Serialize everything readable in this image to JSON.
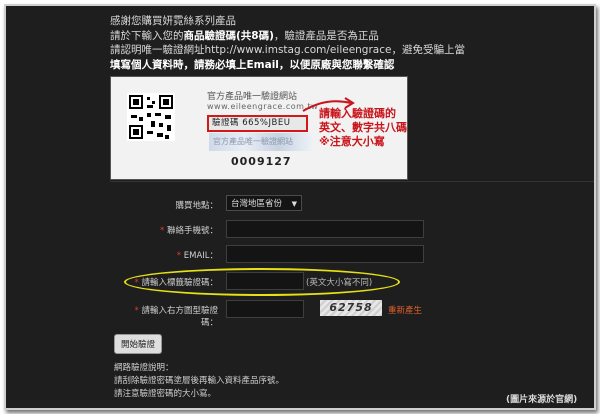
{
  "intro": {
    "line1": "感謝您購買妍霓絲系列產品",
    "line2_pre": "請於下輸入您的",
    "line2_hl": "商品驗證碼(共8碼)",
    "line2_post": "，驗證產品是否為正品",
    "line3": "請認明唯一驗證網址http://www.imstag.com/eileengrace，避免受騙上當",
    "line4": "填寫個人資料時，請務必填上Email，以便原廠與您聯繫確認"
  },
  "sample": {
    "brand": "官方產品唯一驗證網站",
    "brand_url": "www.eileengrace.com.tw",
    "code": "驗證碼 665%JBEU",
    "hologram": "官方產品唯一驗證網站",
    "serial": "0009127",
    "annotation_line1": "請輸入驗證碼的",
    "annotation_line2": "英文、數字共八碼",
    "annotation_line3": "※注意大小寫",
    "annotation_color": "#c8141a"
  },
  "form": {
    "purchase_label": "購買地點：",
    "purchase_value": "台灣地區省份",
    "phone_label": "聯絡手機號：",
    "email_label": "EMAIL：",
    "code_label": "請輸入標籤驗證碼：",
    "code_hint": "(英文大小寫不同)",
    "captcha_label": "請輸入右方圖型驗證碼：",
    "captcha_value": "62758",
    "refresh_label": "重新產生",
    "required_mark": "*",
    "highlight_color": "#e6e014"
  },
  "submit_label": "開始驗證",
  "notes": {
    "title": "網路驗證說明：",
    "line1": "請刮除驗證密碼塗層後再輸入資料產品序號。",
    "line2": "請注意驗證密碼的大小寫。"
  },
  "credit": "(圖片來源於官網)"
}
